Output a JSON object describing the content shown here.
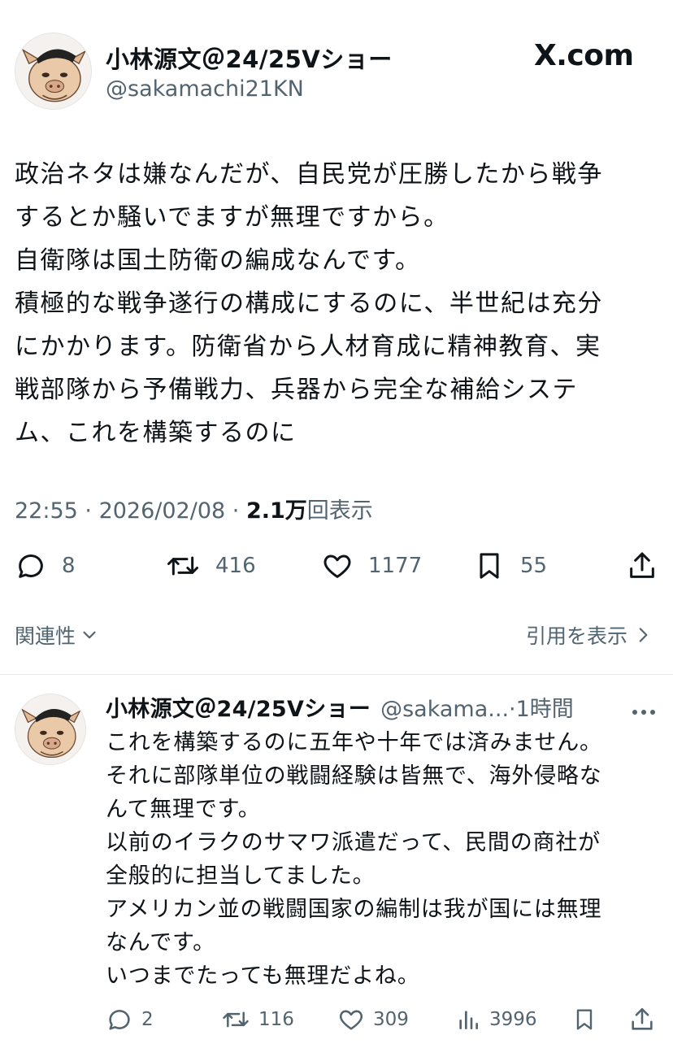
{
  "main_tweet": {
    "display_name": "小林源文＠24/25Vショー",
    "handle": "@sakamachi21KN",
    "site_logo": "X.com",
    "avatar_icon": "pig-with-beret-avatar-icon",
    "body_lines": [
      "政治ネタは嫌なんだが、自民党が圧勝したから戦争",
      "するとか騒いでますが無理ですから。",
      "自衛隊は国土防衛の編成なんです。",
      "積極的な戦争遂行の構成にするのに、半世紀は充分",
      "にかかります。防衛省から人材育成に精神教育、実",
      "戦部隊から予備戦力、兵器から完全な補給システ",
      "ム、これを構築するのに"
    ],
    "time": "22:55",
    "date": "2026/02/08",
    "views_count": "2.1万",
    "views_label": "回表示",
    "stats": {
      "replies": "8",
      "reposts": "416",
      "likes": "1177",
      "bookmarks": "55"
    },
    "related_label": "関連性",
    "quotes_label": "引用を表示"
  },
  "reply_tweet": {
    "display_name": "小林源文＠24/25Vショー",
    "handle_time": "@sakama...·1時間",
    "avatar_icon": "pig-with-beret-avatar-icon",
    "body_lines": [
      "これを構築するのに五年や十年では済みません。",
      "それに部隊単位の戦闘経験は皆無で、海外侵略な",
      "んて無理です。",
      "以前のイラクのサマワ派遣だって、民間の商社が",
      "全般的に担当してました。",
      "アメリカン並の戦闘国家の編制は我が国には無理",
      "なんです。",
      "いつまでたっても無理だよね。"
    ],
    "stats": {
      "replies": "2",
      "reposts": "116",
      "likes": "309",
      "views": "3996"
    }
  },
  "colors": {
    "text": "#0f1419",
    "secondary": "#536471",
    "divider": "#e6ecf0"
  }
}
